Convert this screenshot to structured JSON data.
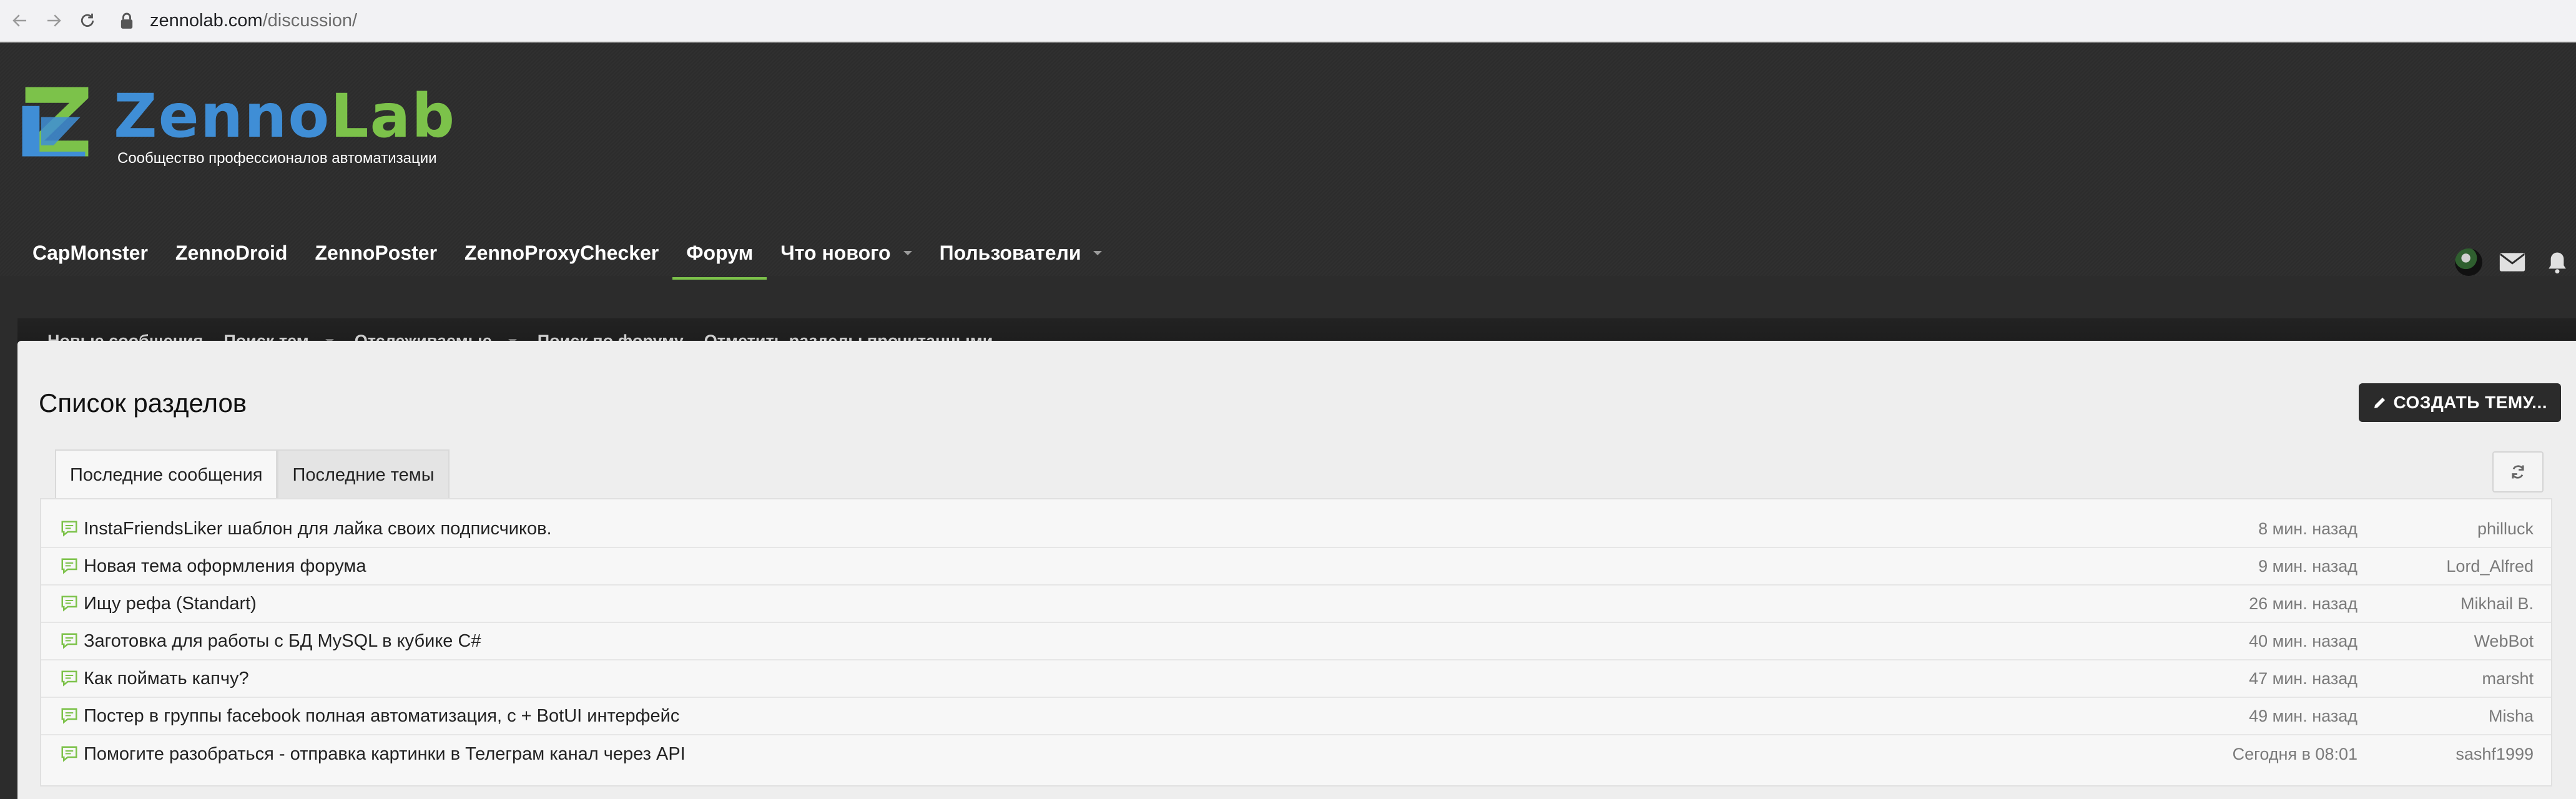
{
  "browser": {
    "url_host": "zennolab.com",
    "url_path": "/discussion/"
  },
  "logo": {
    "word_part1": "Zenno",
    "word_part2": "Lab",
    "tagline": "Сообщество профессионалов автоматизации"
  },
  "main_nav": [
    {
      "label": "CapMonster",
      "has_menu": false,
      "active": false
    },
    {
      "label": "ZennoDroid",
      "has_menu": false,
      "active": false
    },
    {
      "label": "ZennoPoster",
      "has_menu": false,
      "active": false
    },
    {
      "label": "ZennoProxyChecker",
      "has_menu": false,
      "active": false
    },
    {
      "label": "Форум",
      "has_menu": false,
      "active": true
    },
    {
      "label": "Что нового",
      "has_menu": true,
      "active": false
    },
    {
      "label": "Пользователи",
      "has_menu": true,
      "active": false
    }
  ],
  "sub_nav": [
    {
      "label": "Новые сообщения",
      "has_menu": false
    },
    {
      "label": "Поиск тем",
      "has_menu": true
    },
    {
      "label": "Отслеживаемые",
      "has_menu": true
    },
    {
      "label": "Поиск по форуму",
      "has_menu": false
    },
    {
      "label": "Отметить разделы прочитанными",
      "has_menu": false
    }
  ],
  "page": {
    "title": "Список разделов",
    "create_button": "СОЗДАТЬ ТЕМУ..."
  },
  "tabs": [
    {
      "label": "Последние сообщения",
      "active": true
    },
    {
      "label": "Последние темы",
      "active": false
    }
  ],
  "topics": [
    {
      "title": "InstaFriendsLiker шаблон для лайка своих подписчиков.",
      "time": "8 мин. назад",
      "user": "philluck"
    },
    {
      "title": "Новая тема оформления форума",
      "time": "9 мин. назад",
      "user": "Lord_Alfred"
    },
    {
      "title": "Ищу рефа (Standart)",
      "time": "26 мин. назад",
      "user": "Mikhail B."
    },
    {
      "title": "Заготовка для работы с БД MySQL в кубике C#",
      "time": "40 мин. назад",
      "user": "WebBot"
    },
    {
      "title": "Как поймать капчу?",
      "time": "47 мин. назад",
      "user": "marsht"
    },
    {
      "title": "Постер в группы facebook полная автоматизация, с + BotUI интерфейс",
      "time": "49 мин. назад",
      "user": "Misha"
    },
    {
      "title": "Помогите разобраться - отправка картинки в Телеграм канал через API",
      "time": "Сегодня в 08:01",
      "user": "sashf1999"
    }
  ],
  "colors": {
    "brand_blue": "#3f8ed6",
    "brand_green": "#7cc24a",
    "header_bg": "#2c2c2c",
    "topic_icon": "#7cc24a"
  }
}
